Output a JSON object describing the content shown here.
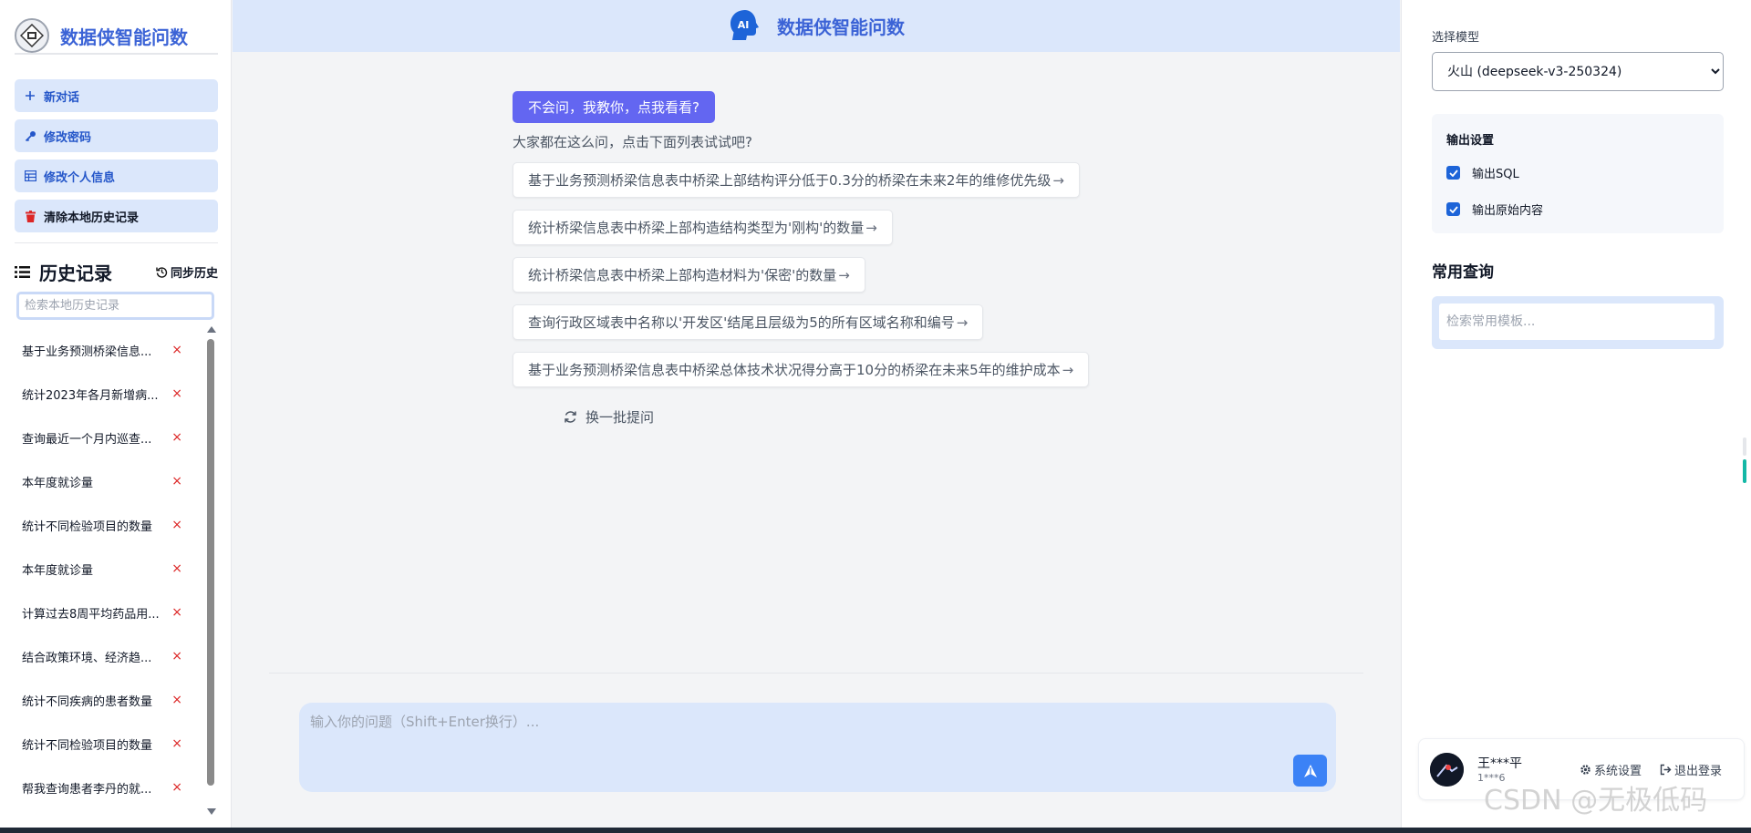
{
  "brand": {
    "title": "数据侠智能问数"
  },
  "nav": {
    "new_chat": "新对话",
    "change_password": "修改密码",
    "edit_profile": "修改个人信息",
    "clear_history": "清除本地历史记录"
  },
  "history": {
    "title": "历史记录",
    "sync": "同步历史",
    "search_placeholder": "检索本地历史记录",
    "items": [
      "基于业务预测桥梁信息...",
      "统计2023年各月新增病...",
      "查询最近一个月内巡查...",
      "本年度就诊量",
      "统计不同检验项目的数量",
      "本年度就诊量",
      "计算过去8周平均药品用...",
      "结合政策环境、经济趋...",
      "统计不同疾病的患者数量",
      "统计不同检验项目的数量",
      "帮我查询患者李丹的就..."
    ],
    "delete_glyph": "×"
  },
  "header": {
    "title": "数据侠智能问数",
    "logo_text": "AI"
  },
  "main": {
    "teach_button": "不会问，我教你，点我看看?",
    "hint": "大家都在这么问，点击下面列表试试吧?",
    "suggestions": [
      "基于业务预测桥梁信息表中桥梁上部结构评分低于0.3分的桥梁在未来2年的维修优先级",
      "统计桥梁信息表中桥梁上部构造结构类型为'刚构'的数量",
      "统计桥梁信息表中桥梁上部构造材料为'保密'的数量",
      "查询行政区域表中名称以'开发区'结尾且层级为5的所有区域名称和编号",
      "基于业务预测桥梁信息表中桥梁总体技术状况得分高于10分的桥梁在未来5年的维护成本"
    ],
    "arrow_glyph": "→",
    "refresh": "换一批提问",
    "input_placeholder": "输入你的问题（Shift+Enter换行）..."
  },
  "right": {
    "model_label": "选择模型",
    "model_selected": "火山 (deepseek-v3-250324)",
    "output_title": "输出设置",
    "output_sql": "输出SQL",
    "output_raw": "输出原始内容",
    "output_sql_checked": true,
    "output_raw_checked": true,
    "common_title": "常用查询",
    "common_placeholder": "检索常用模板..."
  },
  "user": {
    "name": "王***平",
    "id": "1***6",
    "settings": "系统设置",
    "logout": "退出登录"
  },
  "watermark": "CSDN @无极低码",
  "colors": {
    "accent": "#3b63d6",
    "nav_bg": "#dbe7fb",
    "teach_button": "#6366f1",
    "send_button": "#3b82f6",
    "danger": "#dc2626"
  }
}
